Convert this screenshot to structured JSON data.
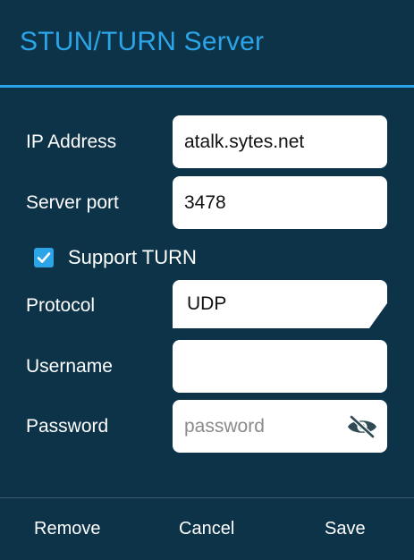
{
  "dialog": {
    "title": "STUN/TURN Server"
  },
  "form": {
    "ip_address": {
      "label": "IP Address",
      "value": "atalk.sytes.net"
    },
    "server_port": {
      "label": "Server port",
      "value": "3478"
    },
    "support_turn": {
      "label": "Support TURN",
      "checked": true
    },
    "protocol": {
      "label": "Protocol",
      "value": "UDP"
    },
    "username": {
      "label": "Username",
      "value": ""
    },
    "password": {
      "label": "Password",
      "placeholder": "password",
      "toggle_icon": "eye-off-icon"
    }
  },
  "actions": {
    "remove": "Remove",
    "cancel": "Cancel",
    "save": "Save"
  },
  "colors": {
    "background": "#0d3349",
    "accent": "#2ba4e8",
    "field_background": "#ffffff"
  }
}
